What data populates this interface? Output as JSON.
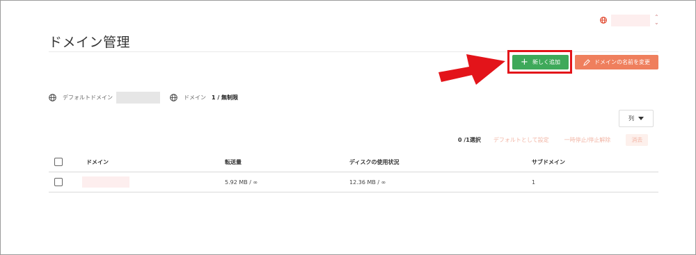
{
  "header": {
    "page_title": "ドメイン管理"
  },
  "toolbar": {
    "add_label": "新しく追加",
    "rename_label": "ドメインの名前を変更"
  },
  "info": {
    "default_domain_label": "デフォルトドメイン",
    "domain_label": "ドメイン",
    "domain_value": "1 / 無制限"
  },
  "columns_button": {
    "label": "列"
  },
  "bulk_actions": {
    "selected_text": "0 /1選択",
    "set_default_label": "デフォルトとして設定",
    "suspend_label": "一時停止/停止解除",
    "delete_label": "消去"
  },
  "table": {
    "headers": {
      "domain": "ドメイン",
      "transfer": "転送量",
      "disk": "ディスクの使用状況",
      "subdomain": "サブドメイン"
    },
    "rows": [
      {
        "transfer": "5.92 MB / ∞",
        "disk": "12.36 MB / ∞",
        "subdomain": "1"
      }
    ]
  },
  "colors": {
    "add_button": "#3ea95a",
    "rename_button": "#ef7f5d",
    "highlight": "#e3141a"
  },
  "icons": [
    "globe-icon",
    "plus-icon",
    "pencil-icon",
    "caret-down-icon",
    "sort-arrows-icon",
    "callout-arrow-icon"
  ]
}
